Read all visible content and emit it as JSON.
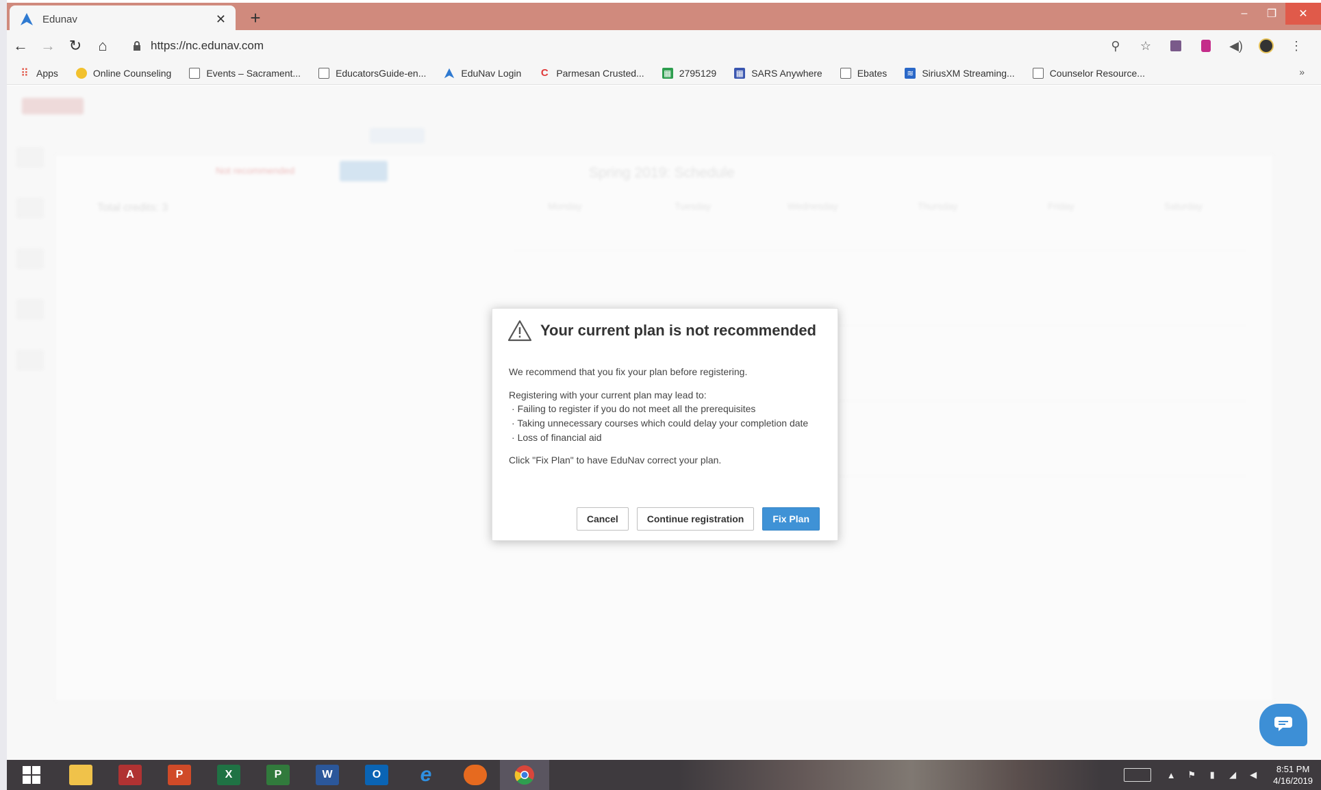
{
  "browser": {
    "tab_title": "Edunav",
    "url": "https://nc.edunav.com",
    "bookmarks": [
      {
        "label": "Apps",
        "color": "#e04a3a"
      },
      {
        "label": "Online Counseling",
        "color": "#f2c12e"
      },
      {
        "label": "Events – Sacrament...",
        "color": "#ffffff"
      },
      {
        "label": "EducatorsGuide-en...",
        "color": "#ffffff"
      },
      {
        "label": "EduNav Login",
        "color": "#2f7ad1"
      },
      {
        "label": "Parmesan Crusted...",
        "color": "#e03a3a"
      },
      {
        "label": "2795129",
        "color": "#2e9e4f"
      },
      {
        "label": "SARS Anywhere",
        "color": "#3b57b0"
      },
      {
        "label": "Ebates",
        "color": "#ffffff"
      },
      {
        "label": "SiriusXM Streaming...",
        "color": "#2a68c8"
      },
      {
        "label": "Counselor Resource...",
        "color": "#ffffff"
      }
    ],
    "bookmarks_more": "»"
  },
  "app": {
    "schedule_title": "Spring 2019: Schedule",
    "status_chip": "Not recommended",
    "total_credits": "Total credits: 3",
    "day_columns": [
      "Monday",
      "Tuesday",
      "Wednesday",
      "Thursday",
      "Friday",
      "Saturday"
    ]
  },
  "dialog": {
    "title": "Your current plan is not recommended",
    "intro": "We recommend that you fix your plan before registering.",
    "lead": "Registering with your current plan may lead to:",
    "bullets": [
      "Failing to register if you do not meet all the prerequisites",
      "Taking unnecessary courses which could delay your completion date",
      "Loss of financial aid"
    ],
    "footer": "Click \"Fix Plan\" to have EduNav correct your plan.",
    "cancel_label": "Cancel",
    "continue_label": "Continue registration",
    "fix_label": "Fix Plan"
  },
  "taskbar": {
    "apps": [
      {
        "name": "file-explorer",
        "text": "",
        "color": "#f0c24a"
      },
      {
        "name": "access",
        "text": "A",
        "color": "#b03232"
      },
      {
        "name": "powerpoint",
        "text": "P",
        "color": "#d04a28"
      },
      {
        "name": "excel",
        "text": "X",
        "color": "#1f7244"
      },
      {
        "name": "project",
        "text": "P",
        "color": "#317a3c"
      },
      {
        "name": "word",
        "text": "W",
        "color": "#2b579a"
      },
      {
        "name": "outlook",
        "text": "O",
        "color": "#0a64b4"
      },
      {
        "name": "internet-explorer",
        "text": "e",
        "color": "#2f8fe0"
      },
      {
        "name": "firefox",
        "text": "",
        "color": "#e66a1f"
      },
      {
        "name": "chrome",
        "text": "",
        "color": "#d9463b"
      }
    ],
    "time": "8:51 PM",
    "date": "4/16/2019"
  },
  "colors": {
    "primary_button": "#3f92d6",
    "title_bar": "#d08a7d"
  }
}
